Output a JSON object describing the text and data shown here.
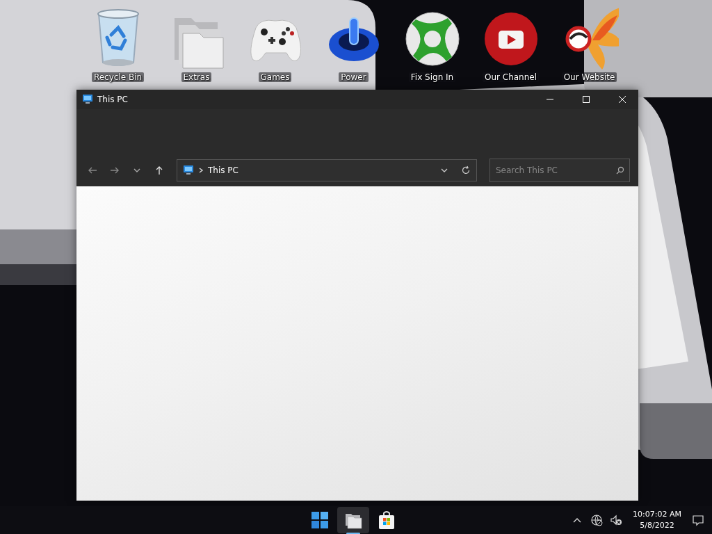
{
  "desktop": {
    "icons": [
      {
        "kind": "bin",
        "label": "Recycle Bin"
      },
      {
        "kind": "folder",
        "label": "Extras"
      },
      {
        "kind": "gamepad",
        "label": "Games"
      },
      {
        "kind": "power",
        "label": "Power"
      },
      {
        "kind": "xball",
        "label": "Fix Sign In"
      },
      {
        "kind": "play",
        "label": "Our Channel"
      },
      {
        "kind": "bird",
        "label": "Our Website"
      }
    ]
  },
  "window": {
    "title": "This PC",
    "address": {
      "path": "This PC"
    },
    "search": {
      "placeholder": "Search This PC"
    }
  },
  "taskbar": {
    "apps": [
      {
        "kind": "start",
        "selected": false
      },
      {
        "kind": "explorer",
        "selected": true
      },
      {
        "kind": "store",
        "selected": false
      }
    ],
    "clock": {
      "time": "10:07:02 AM",
      "date": "5/8/2022"
    }
  }
}
